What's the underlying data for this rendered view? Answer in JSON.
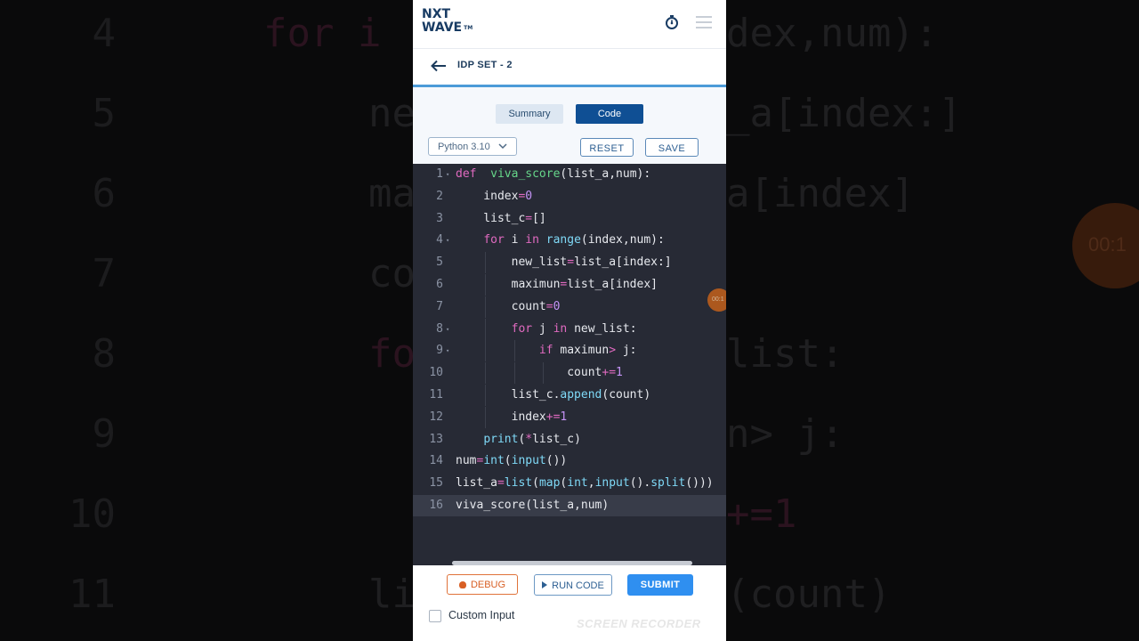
{
  "app": {
    "logo_line1": "NXT",
    "logo_line2": "WAVE",
    "logo_tm": "TM"
  },
  "header": {
    "title": "IDP SET - 2"
  },
  "tabs": [
    {
      "label": "Summary",
      "active": false
    },
    {
      "label": "Code",
      "active": true
    }
  ],
  "toolbar": {
    "language": "Python 3.10",
    "reset_label": "RESET",
    "save_label": "SAVE"
  },
  "editor": {
    "active_line": 16,
    "lines": [
      {
        "n": "1",
        "fold": true
      },
      {
        "n": "2",
        "fold": false
      },
      {
        "n": "3",
        "fold": false
      },
      {
        "n": "4",
        "fold": true
      },
      {
        "n": "5",
        "fold": false
      },
      {
        "n": "6",
        "fold": false
      },
      {
        "n": "7",
        "fold": false
      },
      {
        "n": "8",
        "fold": true
      },
      {
        "n": "9",
        "fold": true
      },
      {
        "n": "10",
        "fold": false
      },
      {
        "n": "11",
        "fold": false
      },
      {
        "n": "12",
        "fold": false
      },
      {
        "n": "13",
        "fold": false
      },
      {
        "n": "14",
        "fold": false
      },
      {
        "n": "15",
        "fold": false
      },
      {
        "n": "16",
        "fold": false
      }
    ],
    "code": [
      "def  viva_score(list_a,num):",
      "    index=0",
      "    list_c=[]",
      "    for i in range(index,num):",
      "        new_list=list_a[index:]",
      "        maximun=list_a[index]",
      "        count=0",
      "        for j in new_list:",
      "            if maximun> j:",
      "                count+=1",
      "        list_c.append(count)",
      "        index+=1",
      "    print(*list_c)",
      "num=int(input())",
      "list_a=list(map(int,input().split()))",
      "viva_score(list_a,num)"
    ]
  },
  "footer": {
    "debug_label": "DEBUG",
    "run_label": "RUN CODE",
    "submit_label": "SUBMIT",
    "custom_input_label": "Custom Input",
    "custom_input_checked": false
  },
  "overlay": {
    "watermark": "SCREEN RECORDER",
    "timer_text": "00:1"
  },
  "background": {
    "line_numbers": [
      "4",
      "5",
      "6",
      "7",
      "8",
      "9",
      "10",
      "11"
    ],
    "fragments": [
      {
        "text": "for i"
      },
      {
        "text": "dex,num):"
      },
      {
        "text": "ne"
      },
      {
        "text": "_a[index:]"
      },
      {
        "text": "ma"
      },
      {
        "text": "a[index]"
      },
      {
        "text": "co"
      },
      {
        "text": "fo"
      },
      {
        "text": "list:"
      },
      {
        "text": "n> j:"
      },
      {
        "text": "+=1"
      },
      {
        "text": "li"
      },
      {
        "text": "(count)"
      }
    ]
  },
  "colors": {
    "editor_bg": "#272a35",
    "accent": "#0f4f94",
    "submit": "#2f8ff0",
    "debug": "#d85f24"
  }
}
